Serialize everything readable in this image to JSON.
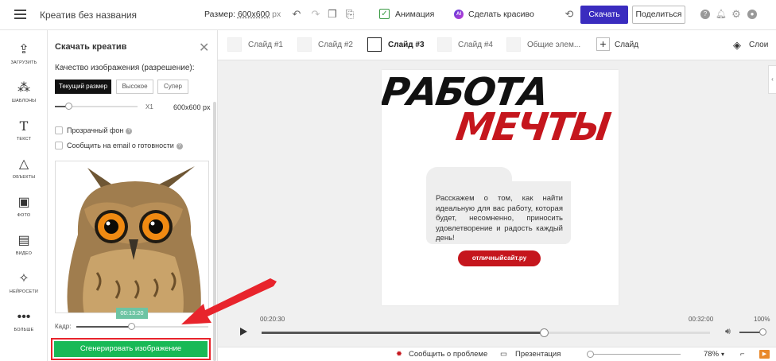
{
  "topbar": {
    "title": "Креатив без названия",
    "size_label": "Размер:",
    "size_value": "600x600",
    "size_unit": "px",
    "animation_label": "Анимация",
    "ai_badge": "AI",
    "beautify_label": "Сделать красиво",
    "download_label": "Скачать",
    "share_label": "Поделиться"
  },
  "sidebar": {
    "items": [
      {
        "label": "ЗАГРУЗИТЬ",
        "icon": "upload-icon"
      },
      {
        "label": "ШАБЛОНЫ",
        "icon": "templates-icon"
      },
      {
        "label": "ТЕКСТ",
        "icon": "text-icon"
      },
      {
        "label": "ОБЪЕКТЫ",
        "icon": "shapes-icon"
      },
      {
        "label": "ФОТО",
        "icon": "photo-icon"
      },
      {
        "label": "ВИДЕО",
        "icon": "video-icon"
      },
      {
        "label": "НЕЙРОСЕТИ",
        "icon": "magic-wand-icon"
      },
      {
        "label": "БОЛЬШЕ",
        "icon": "more-icon"
      }
    ]
  },
  "panel": {
    "title": "Скачать креатив",
    "quality_label": "Качество изображения (разрешение):",
    "quality_options": [
      "Текущий размер",
      "Высокое",
      "Супер"
    ],
    "quality_selected": 0,
    "scale_label": "X1",
    "output_size": "600x600 px",
    "transparent_label": "Прозрачный фон",
    "transparent_checked": false,
    "email_label": "Сообщить на email о готовности",
    "email_checked": false,
    "frame_time": "00:13:20",
    "frame_label": "Кадр:",
    "frame_position": 0.42,
    "generate_label": "Сгенерировать изображение"
  },
  "slides": {
    "tabs": [
      "Слайд #1",
      "Слайд #2",
      "Слайд #3",
      "Слайд #4",
      "Общие элем..."
    ],
    "active_index": 2,
    "add_label": "Слайд",
    "layers_label": "Слои"
  },
  "canvas": {
    "headline_line1": "РАБОТА",
    "headline_line2": "МЕЧТЫ",
    "body": "Расскажем о том, как найти идеальную для вас работу, которая будет, несомненно, приносить удовлетворение и радость каждый день!",
    "site_button": "отличныйсайт.ру",
    "accent_color": "#c5161d"
  },
  "timeline": {
    "current": "00:20:30",
    "total": "00:32:00",
    "volume": "100%",
    "progress": 0.64
  },
  "bottombar": {
    "report_label": "Сообщить о проблеме",
    "presentation_label": "Презентация",
    "zoom": "78%"
  }
}
